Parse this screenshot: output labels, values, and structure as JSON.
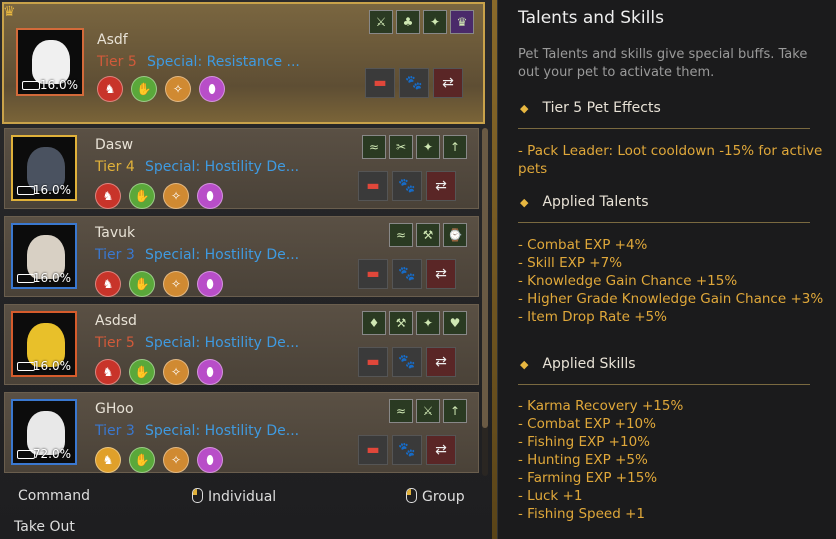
{
  "pets": [
    {
      "name": "Asdf",
      "tier": "Tier 5",
      "tier_color": "#d25a3a",
      "special": "Special: Resistance ...",
      "pct": "16.0%",
      "portrait_color": "#f0f0f0",
      "border": "orange",
      "skills": [
        "⚔",
        "♣",
        "✦",
        "♛"
      ]
    },
    {
      "name": "Dasw",
      "tier": "Tier 4",
      "tier_color": "#e0b13a",
      "special": "Special: Hostility De...",
      "pct": "16.0%",
      "portrait_color": "#4a5260",
      "border": "gold",
      "skills": [
        "≈",
        "✂",
        "✦",
        "↑"
      ]
    },
    {
      "name": "Tavuk",
      "tier": "Tier 3",
      "tier_color": "#3a78d0",
      "special": "Special: Hostility De...",
      "pct": "16.0%",
      "portrait_color": "#d8d0c4",
      "border": "blue",
      "skills": [
        "≈",
        "⚒",
        "⌚"
      ]
    },
    {
      "name": "Asdsd",
      "tier": "Tier 5",
      "tier_color": "#d25a3a",
      "special": "Special: Hostility De...",
      "pct": "16.0%",
      "portrait_color": "#e8c02a",
      "border": "orange",
      "skills": [
        "♦",
        "⚒",
        "✦",
        "♥"
      ]
    },
    {
      "name": "GHoo",
      "tier": "Tier 3",
      "tier_color": "#3a78d0",
      "special": "Special: Hostility De...",
      "pct": "72.0%",
      "portrait_color": "#e8e8e8",
      "border": "blue",
      "skills": [
        "≈",
        "⚔",
        "↑"
      ]
    }
  ],
  "bottom": {
    "command": "Command",
    "individual": "Individual",
    "group": "Group",
    "take_out": "Take Out"
  },
  "right": {
    "title": "Talents and Skills",
    "desc": "Pet Talents and skills give special buffs. Take out your pet to activate them.",
    "sections": [
      {
        "heading": "Tier 5 Pet Effects",
        "lines": [
          "- Pack Leader: Loot cooldown -15% for active pets"
        ]
      },
      {
        "heading": "Applied Talents",
        "lines": [
          "- Combat EXP +4%",
          "- Skill EXP +7%",
          "- Knowledge Gain Chance +15%",
          "- Higher Grade Knowledge Gain Chance +3%",
          "- Item Drop Rate +5%"
        ]
      },
      {
        "heading": "Applied Skills",
        "lines": [
          "- Karma Recovery +15%",
          "- Combat EXP +10%",
          "- Fishing EXP +10%",
          "- Hunting EXP +5%",
          "- Farming EXP +15%",
          "- Luck +1",
          "- Fishing Speed +1"
        ]
      }
    ]
  },
  "colors": {
    "accent_gold": "#e0a83a",
    "tier5": "#d25a3a",
    "tier4": "#e0b13a",
    "tier3": "#3a78d0",
    "special": "#3f9ae0"
  }
}
